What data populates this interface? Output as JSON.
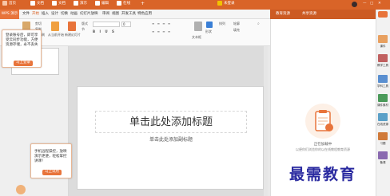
{
  "titlebar": {
    "home": "首页",
    "docs": [
      "文档",
      "文档",
      "演示",
      "编辑",
      "在线"
    ],
    "login": "未登录",
    "colors": {
      "bar": "#d96428"
    }
  },
  "app_tab": "WPS 演示",
  "menu": [
    "文件",
    "开始",
    "插入",
    "设计",
    "切换",
    "动画",
    "幻灯片放映",
    "审阅",
    "视图",
    "开发工具",
    "特色应用"
  ],
  "ribbon": {
    "paste": "粘贴",
    "cut": "剪切",
    "copy": "复制",
    "format": "格式刷",
    "from_start": "从当前开始",
    "new_slide": "新建幻灯片",
    "layout": "版式",
    "section": "节",
    "font_size": "0",
    "text_box": "文本框",
    "shapes": "形状",
    "arrange": "排列",
    "outline": "轮廓",
    "fill": "填充"
  },
  "login_popup": {
    "text": "登录账号后，即可享受云同步功能，方便资源存储，永不丢失",
    "button": "马上登录"
  },
  "phone_popup": {
    "text": "手机远程操控，放映演示更便，轻松掌控讲课！",
    "button": "马上试用"
  },
  "slide": {
    "title_placeholder": "单击此处添加标题",
    "subtitle_placeholder": "单击此处添加副标题"
  },
  "right_panel": {
    "tab_active": "教育资源",
    "tab_other": "共享资源",
    "status": "正在加载中",
    "desc": "以便你们浏览你的以在线教程教育资源"
  },
  "side_tools": [
    "课件",
    "教学工具",
    "学科工具",
    "课件素材",
    "在线资源",
    "习题",
    "备课"
  ],
  "watermark": "最需教育"
}
